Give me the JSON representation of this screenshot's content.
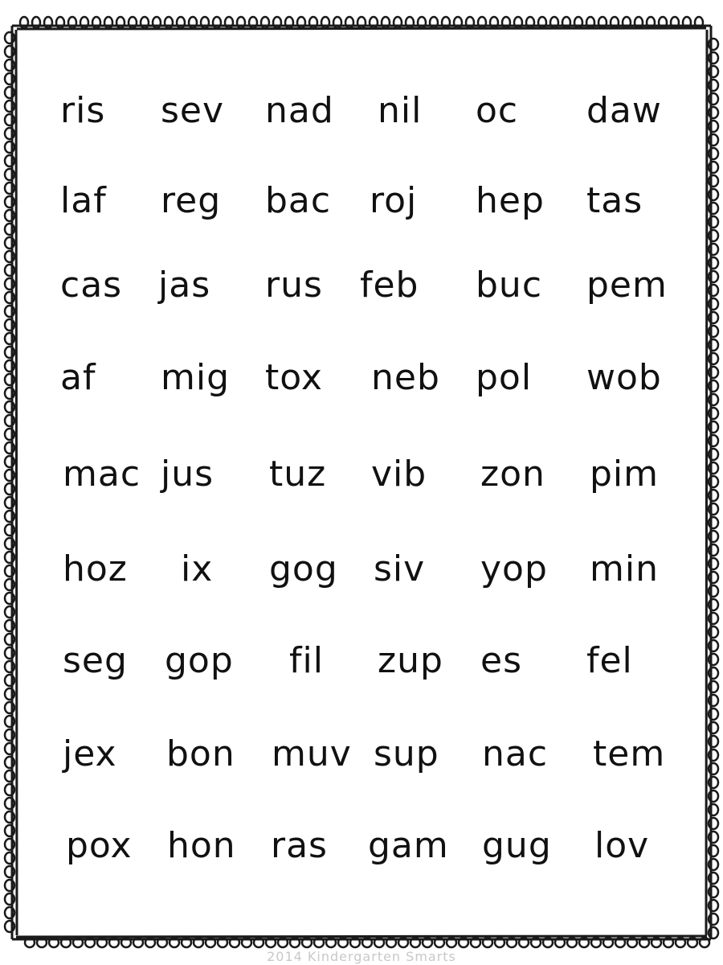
{
  "rows": [
    [
      "ris",
      "sev",
      "nad",
      "nil",
      "oc",
      "daw"
    ],
    [
      "laf",
      "reg",
      "bac",
      "roj",
      "hep",
      "tas"
    ],
    [
      "cas",
      "jas",
      "rus",
      "feb",
      "buc",
      "pem"
    ],
    [
      "af",
      "mig",
      "tox",
      "neb",
      "pol",
      "wob"
    ],
    [
      "mac",
      "jus",
      "tuz",
      "vib",
      "zon",
      "pim"
    ],
    [
      "hoz",
      "ix",
      "gog",
      "siv",
      "yop",
      "min"
    ],
    [
      "seg",
      "gop",
      "fil",
      "zup",
      "es",
      "fel"
    ],
    [
      "jex",
      "bon",
      "muv",
      "sup",
      "nac",
      "tem"
    ],
    [
      "pox",
      "hon",
      "ras",
      "gam",
      "gug",
      "lov"
    ]
  ],
  "footer": "2014 Kindergarten Smarts",
  "colors": {
    "text": "#111111",
    "border": "#1a1a1a",
    "footer": "#c8c8c8"
  },
  "border_style": "loopy-doodle-frame"
}
